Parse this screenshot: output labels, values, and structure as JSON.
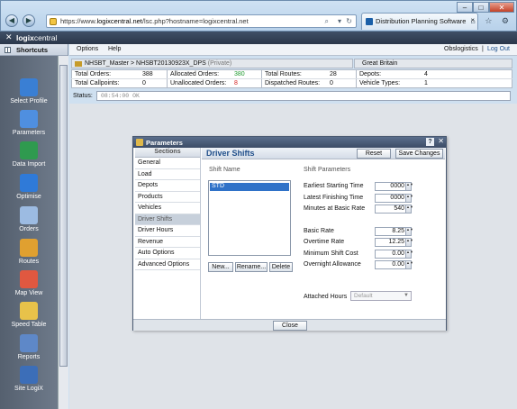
{
  "browser": {
    "url_prefix": "https://www.",
    "url_domain": "logixcentral.net",
    "url_rest": "/lsc.php?hostname=logixcentral.net",
    "tab_title": "Distribution Planning Software Internati...",
    "win_min": "–",
    "win_max": "□",
    "win_close": "✕",
    "back": "◀",
    "forward": "▶",
    "tools": "⌂ ☆ ⚙"
  },
  "app": {
    "close_glyph": "✕",
    "logo_bold": "logix",
    "logo_rest": "central"
  },
  "sidebar": {
    "title": "Shortcuts",
    "items": [
      {
        "label": "Select Profile",
        "color": "#3a7fd4"
      },
      {
        "label": "Parameters",
        "color": "#4f8fe0"
      },
      {
        "label": "Data Import",
        "color": "#2f9a4f"
      },
      {
        "label": "Optimise",
        "color": "#2f7ad8"
      },
      {
        "label": "Orders",
        "color": "#9cbbe2"
      },
      {
        "label": "Routes",
        "color": "#e0a030"
      },
      {
        "label": "Map View",
        "color": "#e05840"
      },
      {
        "label": "Speed Table",
        "color": "#e8c24a"
      },
      {
        "label": "Reports",
        "color": "#5e88c8"
      },
      {
        "label": "Site LogiX",
        "color": "#3c6eb8"
      }
    ]
  },
  "menubar": {
    "options": "Options",
    "help": "Help",
    "user": "Obslogistics",
    "sep": "|",
    "logout": "Log Out"
  },
  "breadcrumb": {
    "master": "NHSBT_Master",
    "arrow": ">",
    "profile": "NHSBT20130923X_DPS",
    "privacy": "(Private)"
  },
  "country": "Great Britain",
  "stats": {
    "total_orders_label": "Total Orders:",
    "total_orders": "388",
    "total_callpoints_label": "Total Callpoints:",
    "total_callpoints": "0",
    "allocated_label": "Allocated Orders:",
    "allocated": "380",
    "unallocated_label": "Unallocated Orders:",
    "unallocated": "8",
    "total_routes_label": "Total Routes:",
    "total_routes": "28",
    "dispatched_label": "Dispatched Routes:",
    "dispatched": "0",
    "depots_label": "Depots:",
    "depots": "4",
    "vehicle_types_label": "Vehicle Types:",
    "vehicle_types": "1"
  },
  "status": {
    "label": "Status:",
    "value": "08:54:00 OK"
  },
  "dialog": {
    "title": "Parameters",
    "help": "?",
    "close": "✕",
    "sections_header": "Sections",
    "sections": [
      "General",
      "Load",
      "Depots",
      "Products",
      "Vehicles",
      "Driver Shifts",
      "Driver Hours",
      "Revenue",
      "Auto Options",
      "Advanced Options"
    ],
    "selected_section": "Driver Shifts",
    "heading": "Driver Shifts",
    "reset": "Reset",
    "save": "Save Changes",
    "shift_name_group": "Shift Name",
    "shift_params_group": "Shift Parameters",
    "shifts": [
      "STD"
    ],
    "btn_new": "New...",
    "btn_rename": "Rename...",
    "btn_delete": "Delete",
    "params": [
      {
        "label": "Earliest Starting Time",
        "value": "0000"
      },
      {
        "label": "Latest Finishing Time",
        "value": "0000"
      },
      {
        "label": "Minutes at Basic Rate",
        "value": "540"
      },
      {
        "label": "Basic Rate",
        "value": "8.25"
      },
      {
        "label": "Overtime Rate",
        "value": "12.25"
      },
      {
        "label": "Minimum Shift Cost",
        "value": "0.00"
      },
      {
        "label": "Overnight Allowance",
        "value": "0.00"
      }
    ],
    "spin_glyph": "▲▼",
    "attached_label": "Attached Hours",
    "attached_value": "Default",
    "attached_arrow": "▼",
    "close_button": "Close"
  }
}
